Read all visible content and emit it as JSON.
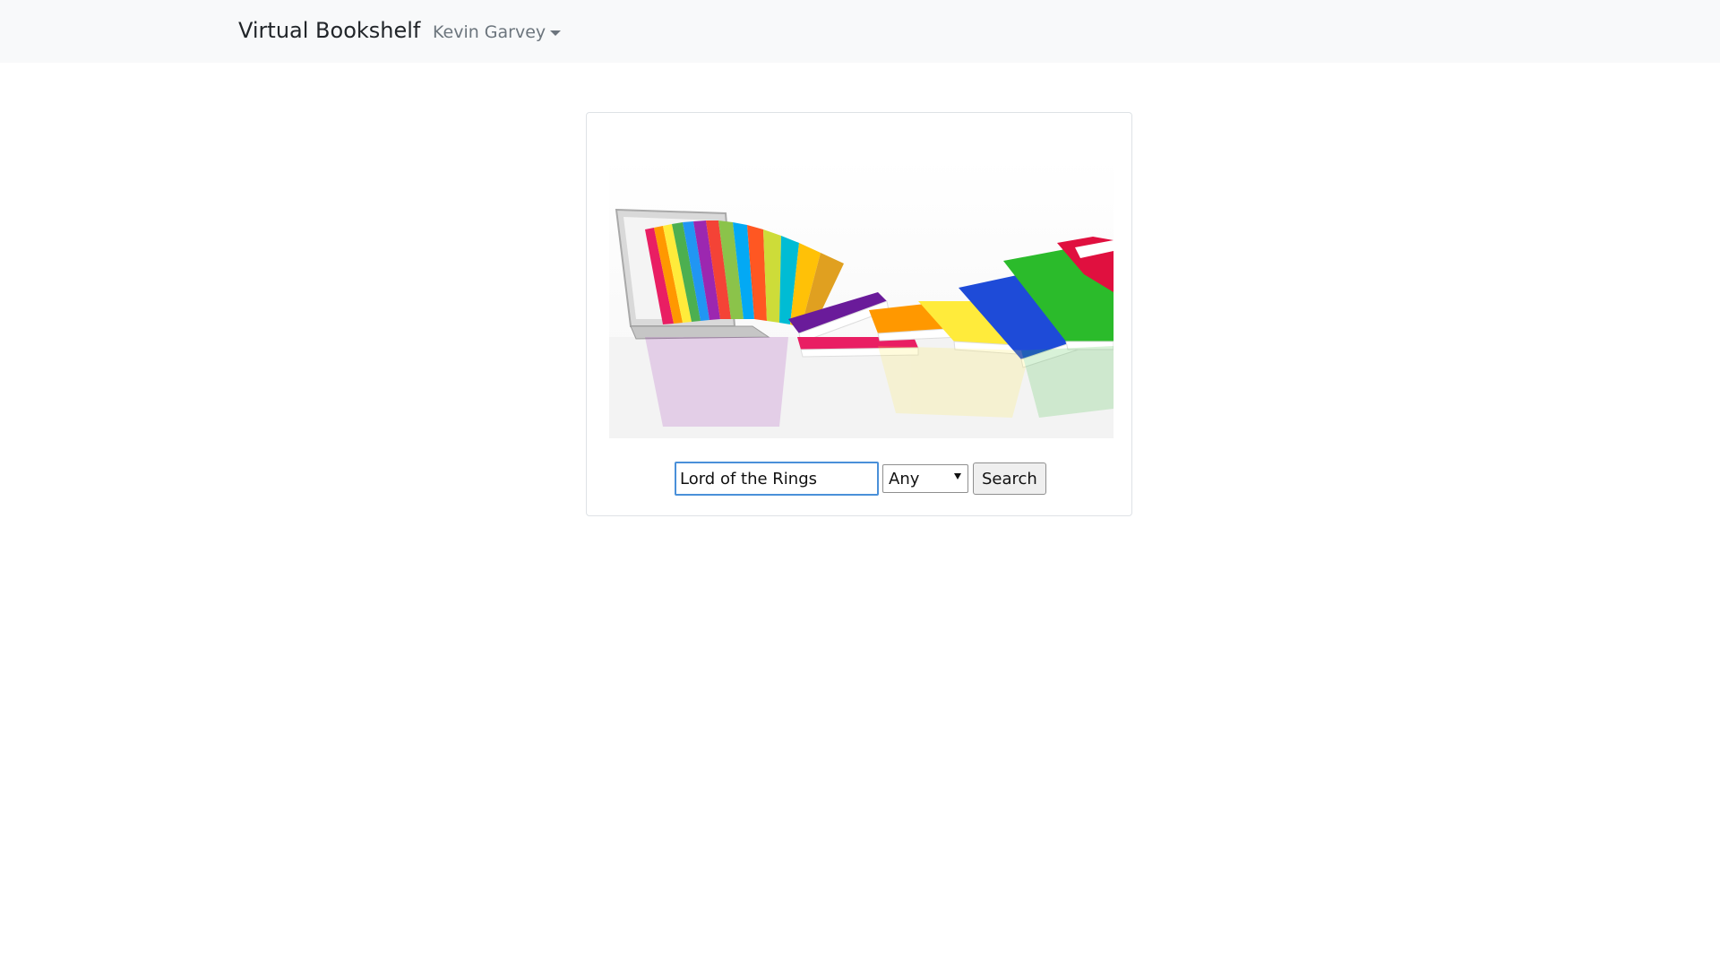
{
  "navbar": {
    "brand": "Virtual Bookshelf",
    "user_name": "Kevin Garvey"
  },
  "search": {
    "query": "Lord of the Rings",
    "filter_selected": "Any",
    "button_label": "Search"
  },
  "colors": {
    "navbar_bg": "#f8f9fa",
    "input_focus_border": "#4a90d9",
    "muted_text": "#6c757d"
  },
  "icons": {
    "user_menu": "caret-down-icon",
    "select": "dropdown-arrow-icon"
  }
}
